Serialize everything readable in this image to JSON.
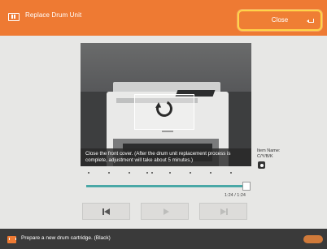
{
  "header": {
    "title": "Replace Drum Unit",
    "close_label": "Close"
  },
  "video": {
    "caption": "Close the front cover. (After the drum unit replacement process is complete, adjustment will take about 5 minutes.)"
  },
  "playback": {
    "progress": 1.0,
    "time": "1:24 / 1:24"
  },
  "item": {
    "label": "Item Name:",
    "value": "C/Y/B/K",
    "icon": "gear-icon"
  },
  "footer": {
    "message": "Prepare a new drum cartridge. (Black)"
  },
  "colors": {
    "header": "#ee7a33",
    "close_border": "#ffd34a",
    "progress": "#4aa8a6",
    "footer": "#3a3a3a"
  }
}
